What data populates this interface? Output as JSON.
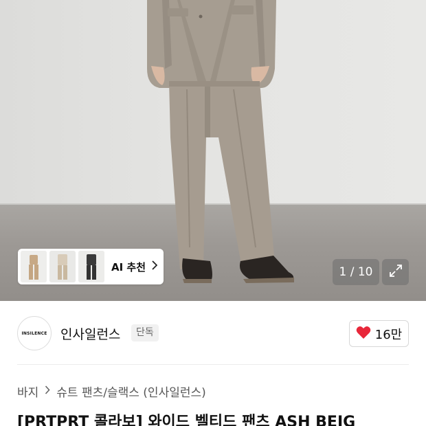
{
  "gallery": {
    "counter": "1 / 10",
    "ai_recommend": {
      "label": "AI 추천",
      "thumbnails": [
        "beige-outfit-thumbnail",
        "light-outfit-thumbnail",
        "black-outfit-thumbnail"
      ]
    }
  },
  "brand": {
    "logo_text": "INSILENCE",
    "name": "인사일런스",
    "badge": "단독"
  },
  "like": {
    "count": "16만"
  },
  "breadcrumb": {
    "items": [
      "바지",
      "슈트 팬츠/슬랙스 (인사일런스)"
    ]
  },
  "product": {
    "title": "[PRTPRT 콜라보] 와이드 벨티드 팬츠 ASH BEIG"
  },
  "colors": {
    "heart": "#e8273a",
    "suit": "#a69c90",
    "background": "#e4e4e2"
  },
  "icons": [
    "chevron-right-icon",
    "expand-icon",
    "heart-icon"
  ]
}
